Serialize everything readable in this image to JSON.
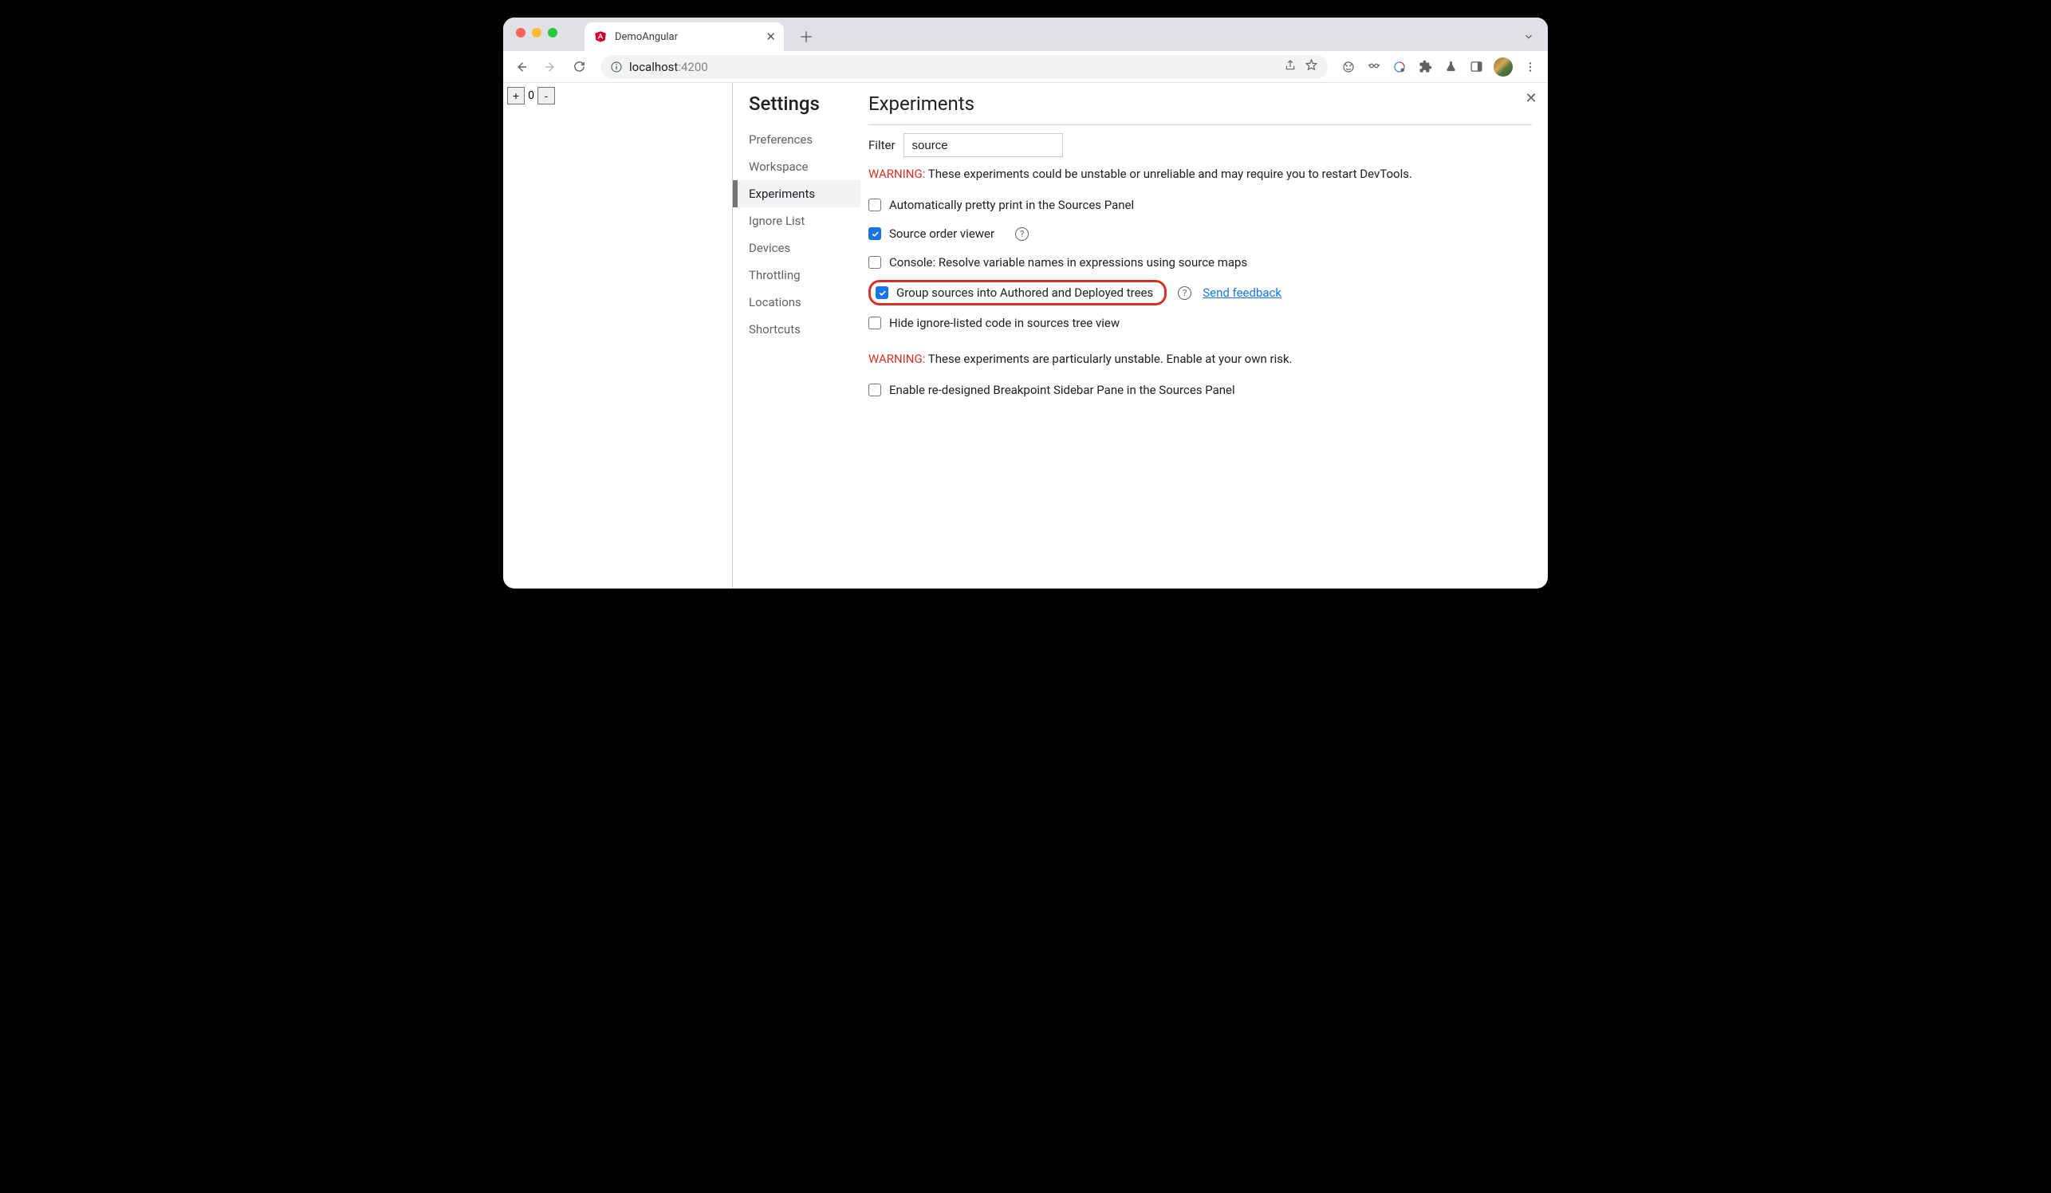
{
  "browser": {
    "tab_title": "DemoAngular",
    "url_host": "localhost",
    "url_port": ":4200"
  },
  "page": {
    "counter_value": "0"
  },
  "settings": {
    "title": "Settings",
    "nav": [
      {
        "label": "Preferences",
        "active": false
      },
      {
        "label": "Workspace",
        "active": false
      },
      {
        "label": "Experiments",
        "active": true
      },
      {
        "label": "Ignore List",
        "active": false
      },
      {
        "label": "Devices",
        "active": false
      },
      {
        "label": "Throttling",
        "active": false
      },
      {
        "label": "Locations",
        "active": false
      },
      {
        "label": "Shortcuts",
        "active": false
      }
    ]
  },
  "experiments": {
    "title": "Experiments",
    "filter_label": "Filter",
    "filter_value": "source",
    "warning1_prefix": "WARNING:",
    "warning1_text": " These experiments could be unstable or unreliable and may require you to restart DevTools.",
    "warning2_prefix": "WARNING:",
    "warning2_text": " These experiments are particularly unstable. Enable at your own risk.",
    "feedback_link": "Send feedback",
    "opts": {
      "prettyprint": {
        "label": "Automatically pretty print in the Sources Panel",
        "checked": false
      },
      "sourceorder": {
        "label": "Source order viewer",
        "checked": true
      },
      "consolevar": {
        "label": "Console: Resolve variable names in expressions using source maps",
        "checked": false
      },
      "groupsrc": {
        "label": "Group sources into Authored and Deployed trees",
        "checked": true
      },
      "hideignore": {
        "label": "Hide ignore-listed code in sources tree view",
        "checked": false
      },
      "breakpoint": {
        "label": "Enable re-designed Breakpoint Sidebar Pane in the Sources Panel",
        "checked": false
      }
    }
  }
}
